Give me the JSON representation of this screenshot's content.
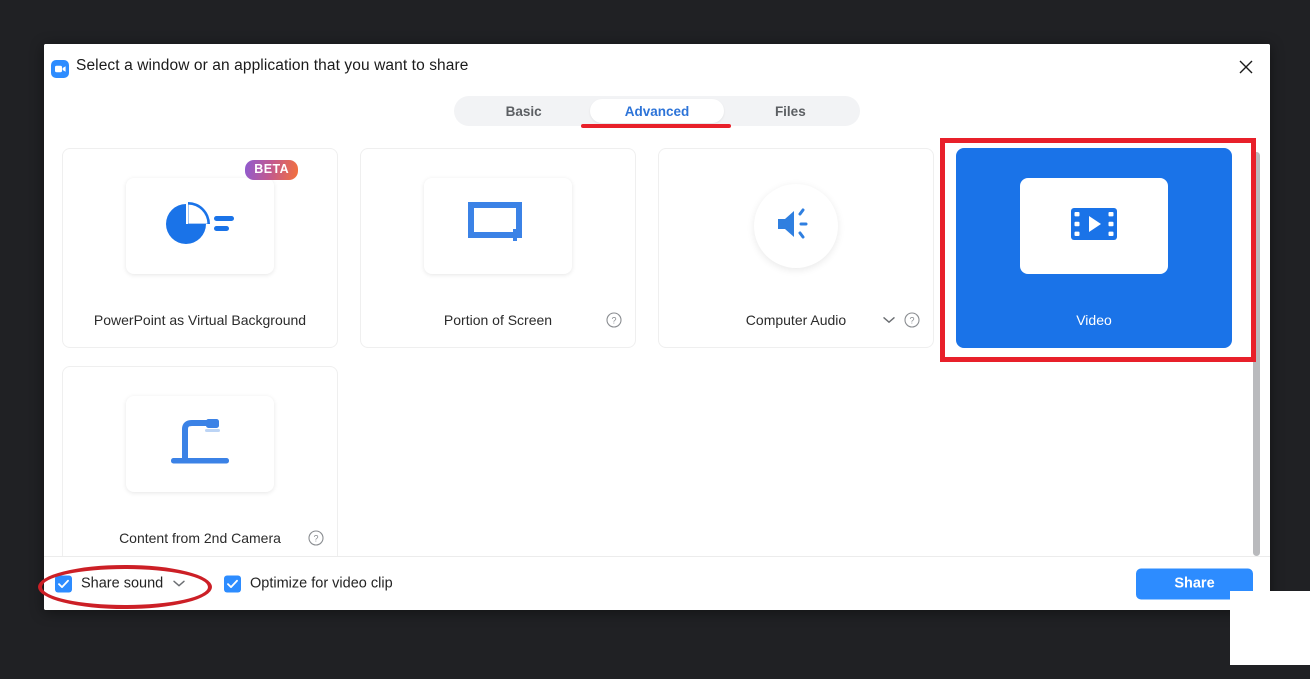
{
  "window": {
    "title": "Select a window or an application that you want to share",
    "logo_icon": "zoom-camera-icon",
    "close_icon": "close-icon"
  },
  "tabs": [
    {
      "label": "Basic",
      "active": false
    },
    {
      "label": "Advanced",
      "active": true
    },
    {
      "label": "Files",
      "active": false
    }
  ],
  "cards": [
    {
      "label": "PowerPoint as Virtual Background",
      "icon": "pie-chart-icon",
      "badge": "BETA",
      "selected": false,
      "has_help": false,
      "has_chevron": false
    },
    {
      "label": "Portion of Screen",
      "icon": "screen-portion-icon",
      "selected": false,
      "has_help": true,
      "has_chevron": false
    },
    {
      "label": "Computer Audio",
      "icon": "speaker-icon",
      "selected": false,
      "has_help": true,
      "has_chevron": true
    },
    {
      "label": "Video",
      "icon": "film-play-icon",
      "selected": true,
      "has_help": false,
      "has_chevron": false
    },
    {
      "label": "Content from 2nd Camera",
      "icon": "document-camera-icon",
      "selected": false,
      "has_help": true,
      "has_chevron": false
    }
  ],
  "footer": {
    "share_sound": {
      "label": "Share sound",
      "checked": true,
      "chevron_icon": "chevron-down-icon"
    },
    "optimize_video": {
      "label": "Optimize for video clip",
      "checked": true
    },
    "share_button": "Share"
  },
  "colors": {
    "accent_blue": "#2d8cff",
    "selected_blue": "#1a73e8",
    "tab_active_text": "#2d74d8",
    "annotation_red": "#e8202a",
    "scrollbar_gray": "#b9babd",
    "desktop_bg": "#202124"
  },
  "annotations": [
    {
      "type": "underline",
      "target": "tab-advanced",
      "color": "#e8202a"
    },
    {
      "type": "rectangle",
      "target": "card-video",
      "color": "#e8202a"
    },
    {
      "type": "ellipse",
      "target": "share-sound-checkbox",
      "color": "#cc1f26"
    }
  ]
}
